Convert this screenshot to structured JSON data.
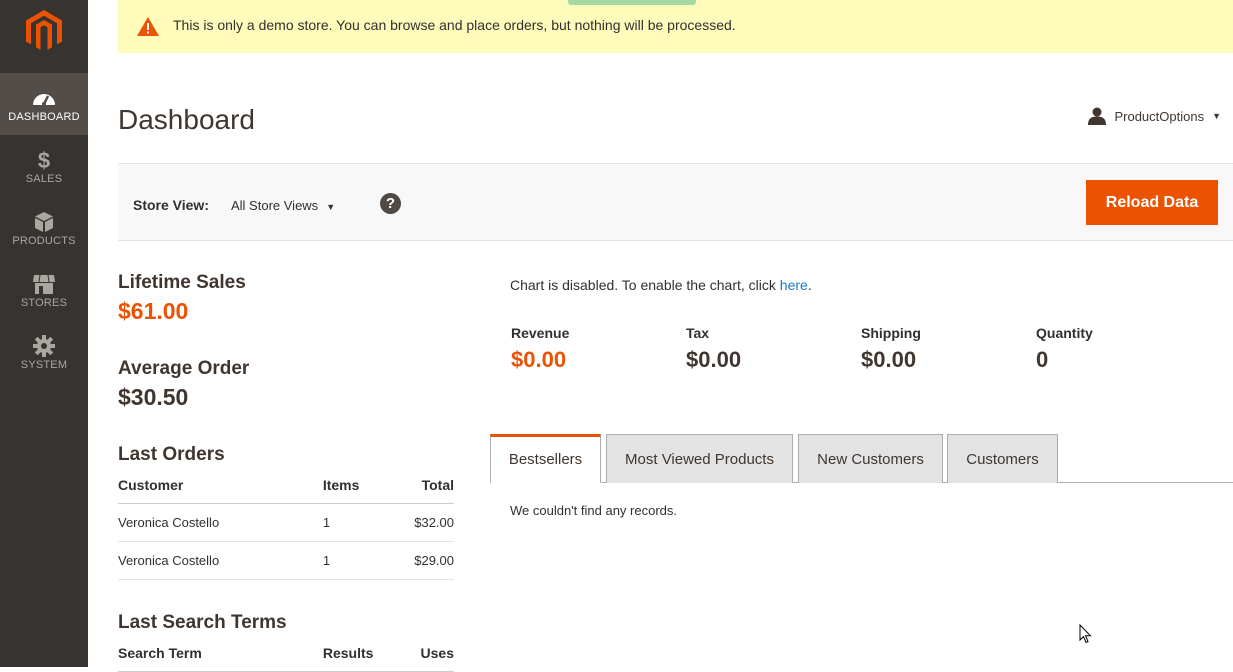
{
  "sidebar": {
    "logo": "magento-logo",
    "items": [
      {
        "label": "DASHBOARD",
        "icon": "dashboard-gauge-icon",
        "active": true
      },
      {
        "label": "SALES",
        "icon": "dollar-icon"
      },
      {
        "label": "PRODUCTS",
        "icon": "box-icon"
      },
      {
        "label": "STORES",
        "icon": "storefront-icon"
      },
      {
        "label": "SYSTEM",
        "icon": "gear-icon"
      }
    ]
  },
  "notice": {
    "icon": "warning-icon",
    "text": "This is only a demo store. You can browse and place orders, but nothing will be processed."
  },
  "header": {
    "title": "Dashboard",
    "account_name": "ProductOptions"
  },
  "toolbar": {
    "store_label": "Store View:",
    "store_value": "All Store Views",
    "help_label": "?",
    "reload_label": "Reload Data"
  },
  "stats": {
    "lifetime_label": "Lifetime Sales",
    "lifetime_value": "$61.00",
    "average_label": "Average Order",
    "average_value": "$30.50"
  },
  "last_orders": {
    "title": "Last Orders",
    "columns": [
      "Customer",
      "Items",
      "Total"
    ],
    "rows": [
      {
        "customer": "Veronica Costello",
        "items": "1",
        "total": "$32.00"
      },
      {
        "customer": "Veronica Costello",
        "items": "1",
        "total": "$29.00"
      }
    ]
  },
  "last_search": {
    "title": "Last Search Terms",
    "columns": [
      "Search Term",
      "Results",
      "Uses"
    ]
  },
  "chart": {
    "note_prefix": "Chart is disabled. To enable the chart, click ",
    "note_link": "here",
    "note_suffix": "."
  },
  "totals": [
    {
      "label": "Revenue",
      "value": "$0.00"
    },
    {
      "label": "Tax",
      "value": "$0.00"
    },
    {
      "label": "Shipping",
      "value": "$0.00"
    },
    {
      "label": "Quantity",
      "value": "0"
    }
  ],
  "tabs": [
    {
      "label": "Bestsellers",
      "active": true
    },
    {
      "label": "Most Viewed Products"
    },
    {
      "label": "New Customers"
    },
    {
      "label": "Customers"
    }
  ],
  "tab_content": {
    "empty_text": "We couldn't find any records."
  },
  "colors": {
    "accent": "#eb5202",
    "sidebar": "#373330",
    "notice": "#fffbbb",
    "link": "#1979c3"
  }
}
